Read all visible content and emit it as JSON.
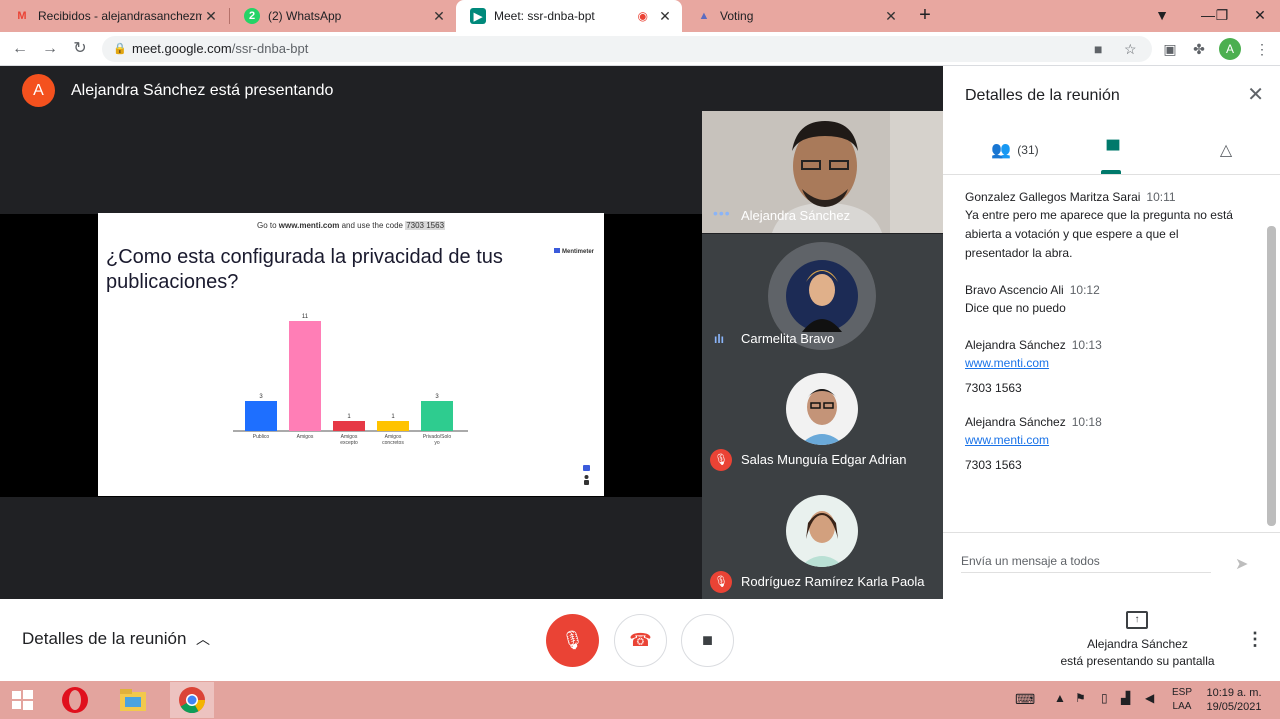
{
  "browser": {
    "tabs": [
      {
        "title": "Recibidos - alejandrasanchezmar",
        "icon": "gmail-icon"
      },
      {
        "title": "(2) WhatsApp",
        "icon": "whatsapp-icon"
      },
      {
        "title": "Meet: ssr-dnba-bpt",
        "icon": "meet-icon",
        "active": true
      },
      {
        "title": "Voting",
        "icon": "voting-icon"
      }
    ],
    "url_host": "meet.google.com",
    "url_path": "/ssr-dnba-bpt",
    "profile_initial": "A"
  },
  "meeting": {
    "presenter_initial": "A",
    "presenter_banner": "Alejandra Sánchez está presentando",
    "slide": {
      "top_pre": "Go to ",
      "top_site": "www.menti.com",
      "top_mid": " and use the code ",
      "top_code": "7303 1563",
      "question": "¿Como esta configurada la privacidad de tus publicaciones?",
      "brand": "Mentimeter"
    },
    "participants": [
      {
        "name": "Alejandra Sánchez"
      },
      {
        "name": "Carmelita Bravo"
      },
      {
        "name": "Salas Munguía Edgar Adrian"
      },
      {
        "name": "Rodríguez Ramírez Karla Paola"
      }
    ]
  },
  "chart_data": {
    "type": "bar",
    "categories": [
      "Publico",
      "Amigos",
      "Amigos excepto",
      "Amigos concretos",
      "Privado/Solo yo"
    ],
    "values": [
      3,
      11,
      1,
      1,
      3
    ],
    "colors": [
      "#1e6fff",
      "#ff7eb6",
      "#e63946",
      "#ffc300",
      "#2ecc8f"
    ]
  },
  "panel": {
    "title": "Detalles de la reunión",
    "people_count": "(31)",
    "messages": [
      {
        "author": "Gonzalez Gallegos Maritza Sarai",
        "time": "10:11",
        "text": "Ya entre pero me aparece que la pregunta no está abierta a votación y que espere a que el presentador la abra."
      },
      {
        "author": "Bravo Ascencio Ali",
        "time": "10:12",
        "text": "Dice que no puedo"
      },
      {
        "author": "Alejandra Sánchez",
        "time": "10:13",
        "link": "www.menti.com",
        "code": "7303 1563"
      },
      {
        "author": "Alejandra Sánchez",
        "time": "10:18",
        "link": "www.menti.com",
        "code": "7303 1563"
      }
    ],
    "input_placeholder": "Envía un mensaje a todos"
  },
  "bottom": {
    "details_label": "Detalles de la reunión",
    "presenting_line1": "Alejandra Sánchez",
    "presenting_line2": "está presentando su pantalla"
  },
  "taskbar": {
    "lang_line1": "ESP",
    "lang_line2": "LAA",
    "time": "10:19 a. m.",
    "date": "19/05/2021"
  }
}
